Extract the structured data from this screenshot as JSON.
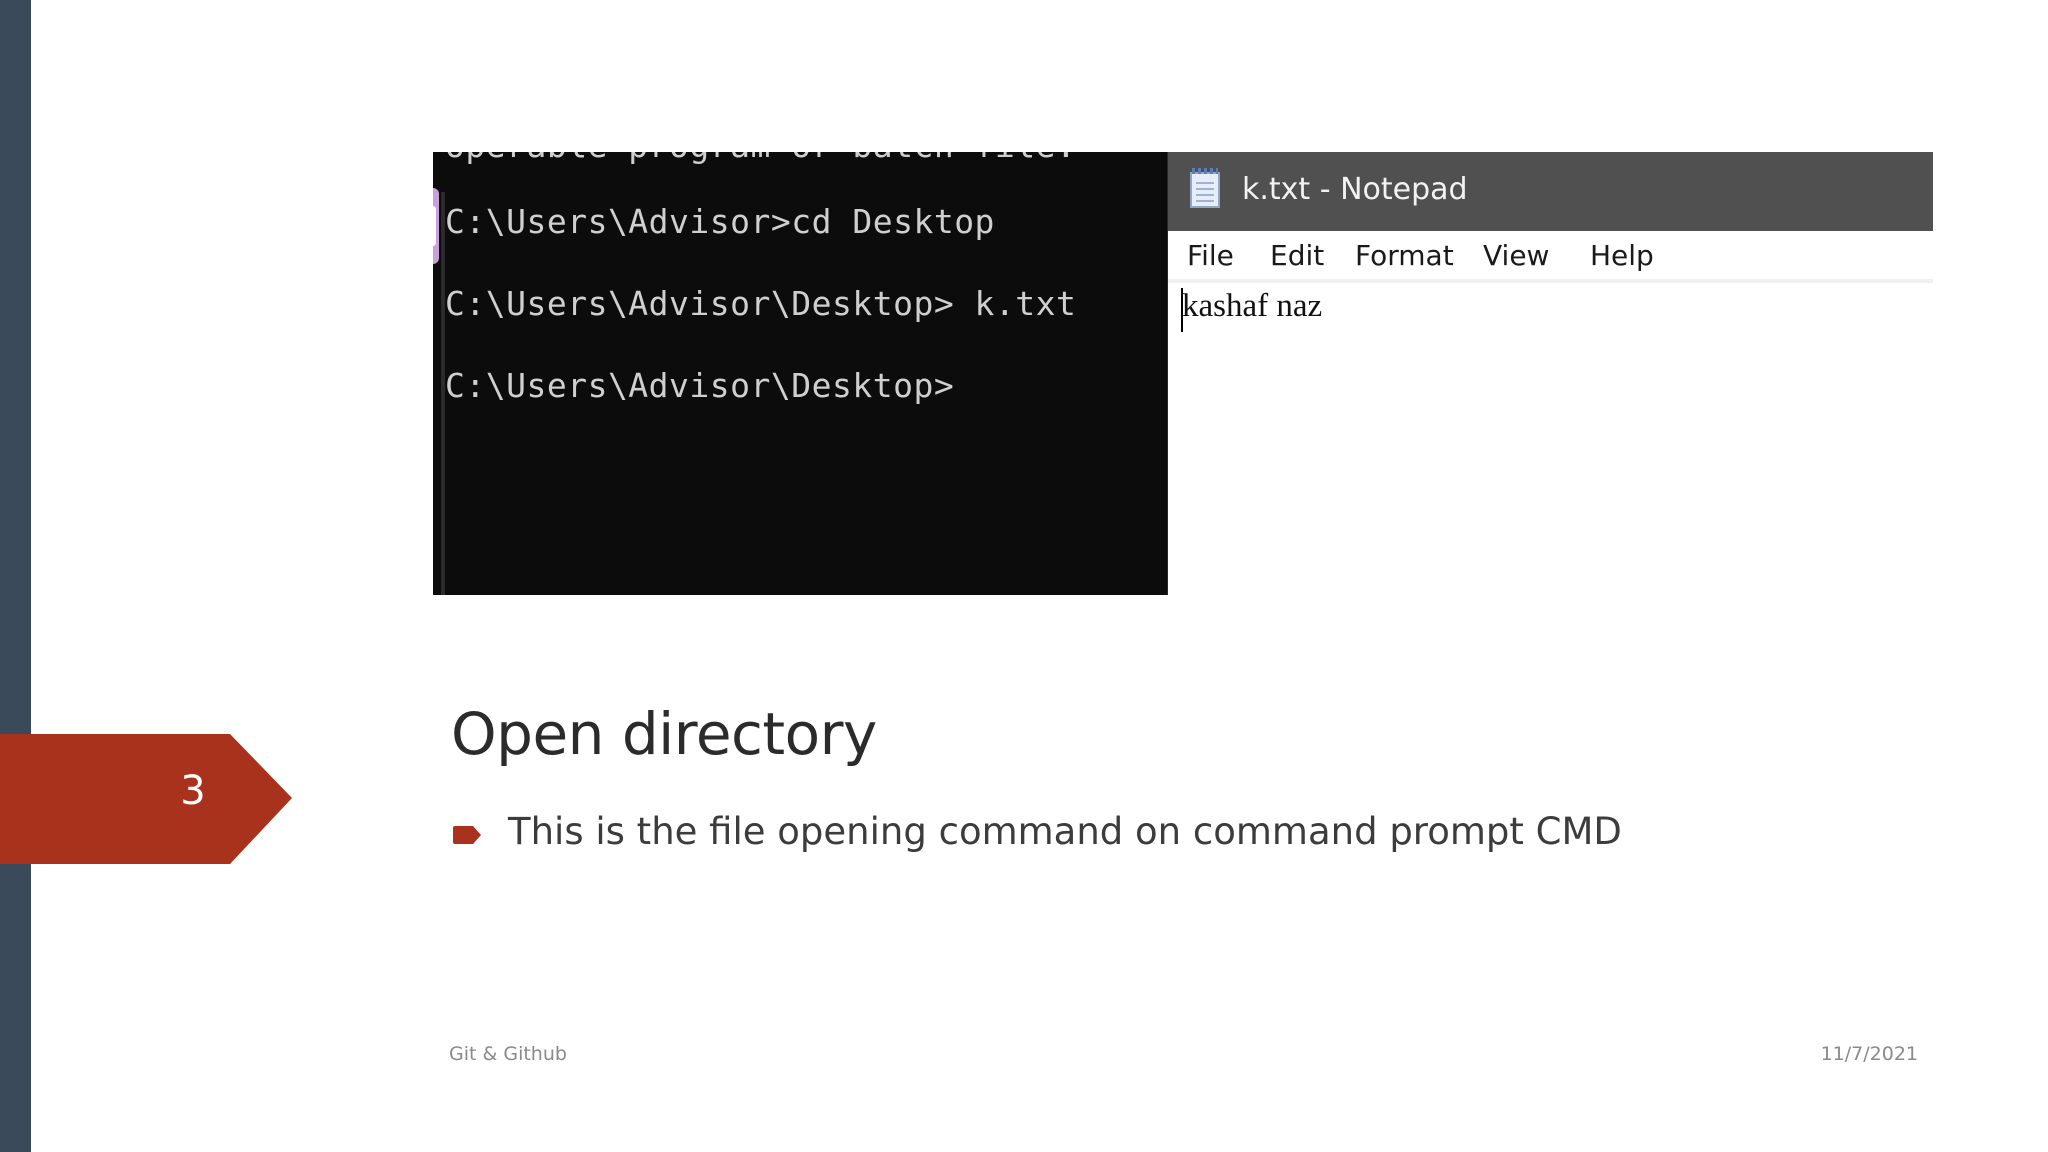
{
  "slide": {
    "number": "3",
    "title": "Open directory",
    "bullets": [
      "This is the file opening command on command prompt CMD"
    ]
  },
  "footer": {
    "left": "Git & Github",
    "right": "11/7/2021"
  },
  "cmd": {
    "lines": [
      "C:\\Users\\Advisor>cd Desktop",
      "C:\\Users\\Advisor\\Desktop> k.txt",
      "C:\\Users\\Advisor\\Desktop>"
    ]
  },
  "notepad": {
    "title": "k.txt - Notepad",
    "menu": [
      "File",
      "Edit",
      "Format",
      "View",
      "Help"
    ],
    "content": "kashaf naz"
  },
  "colors": {
    "accent": "#a8321c",
    "sidebar": "#3b4a5a",
    "terminal_bg": "#0c0c0c",
    "notepad_titlebar": "#505050"
  }
}
